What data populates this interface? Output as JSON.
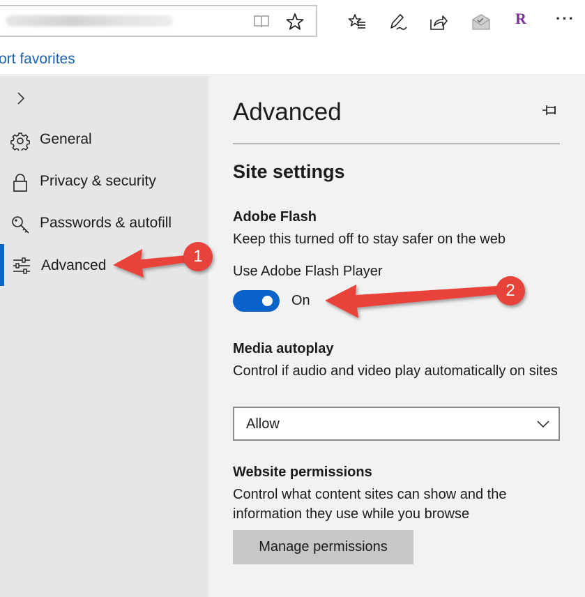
{
  "toolbar": {
    "icons": [
      "reading-view-icon",
      "favorite-star-icon",
      "favorites-hub-icon",
      "pen-icon",
      "share-icon",
      "extension-mail-icon",
      "extension-r-icon",
      "more-icon"
    ],
    "extension_letter": "R",
    "more": "···"
  },
  "favorites_bar": {
    "link": "ort favorites"
  },
  "sidebar": {
    "items": [
      {
        "label": "General",
        "icon": "gear-icon"
      },
      {
        "label": "Privacy & security",
        "icon": "lock-icon"
      },
      {
        "label": "Passwords & autofill",
        "icon": "key-icon"
      },
      {
        "label": "Advanced",
        "icon": "sliders-icon",
        "active": true
      }
    ],
    "accent_color": "#0a63c9"
  },
  "panel": {
    "title": "Advanced",
    "section_title": "Site settings",
    "flash": {
      "heading": "Adobe Flash",
      "description": "Keep this turned off to stay safer on the web",
      "toggle_label": "Use Adobe Flash Player",
      "toggle_state": "On"
    },
    "autoplay": {
      "heading": "Media autoplay",
      "description": "Control if audio and video play automatically on sites",
      "selected": "Allow"
    },
    "permissions": {
      "heading": "Website permissions",
      "description": "Control what content sites can show and the information they use while you browse",
      "button": "Manage permissions"
    }
  },
  "annotations": {
    "badges": [
      "1",
      "2"
    ],
    "color": "#e8433a"
  }
}
